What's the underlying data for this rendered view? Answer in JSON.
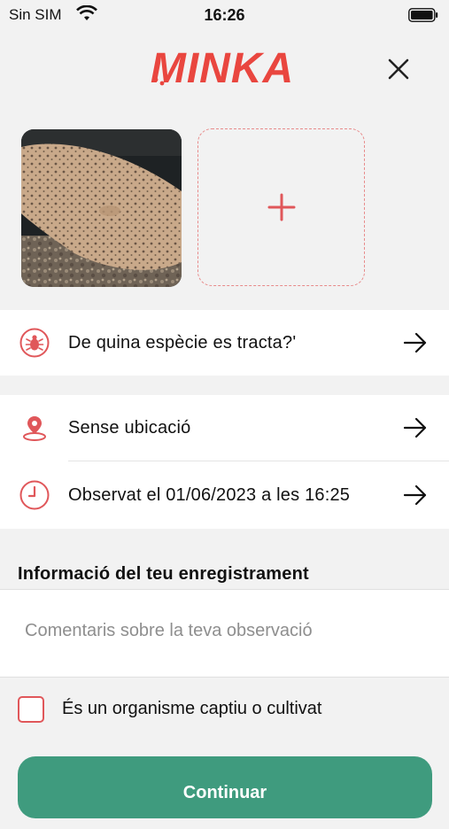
{
  "status_bar": {
    "carrier": "Sin SIM",
    "time": "16:26"
  },
  "header": {
    "logo_text": "MINKA",
    "brand_color": "#e9463f"
  },
  "rows": [
    {
      "label": "De quina espècie es tracta?'",
      "icon": "bug-icon"
    },
    {
      "label": "Sense ubicació",
      "icon": "location-pin-icon"
    },
    {
      "label": "Observat el 01/06/2023 a les 16:25",
      "icon": "clock-icon"
    }
  ],
  "section_title": "Informació del teu enregistrament",
  "comment": {
    "placeholder": "Comentaris sobre la teva observació",
    "value": ""
  },
  "captive": {
    "label": "És un organisme captiu o cultivat",
    "checked": false
  },
  "continue_label": "Continuar",
  "colors": {
    "accent": "#e0575a",
    "primary_button": "#3f9b7e"
  }
}
